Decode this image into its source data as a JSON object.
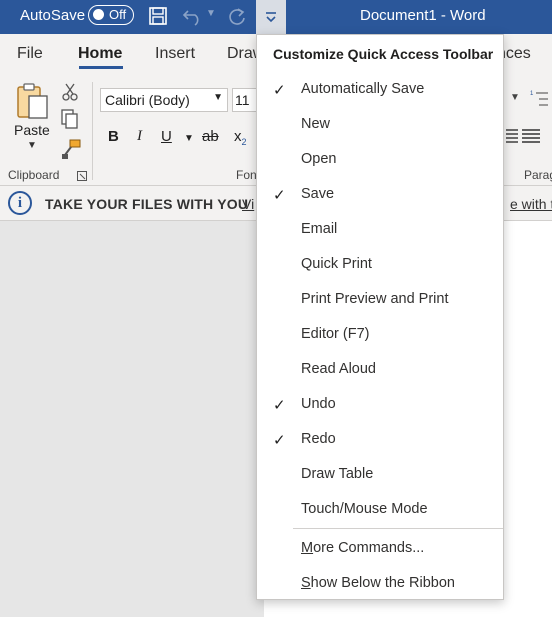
{
  "titlebar": {
    "autosave_label": "AutoSave",
    "autosave_state": "Off",
    "document_title": "Document1  -  Word"
  },
  "tabs": [
    "File",
    "Home",
    "Insert",
    "Draw",
    "nces"
  ],
  "ribbon": {
    "paste_label": "Paste",
    "clipboard_group": "Clipboard",
    "font_name": "Calibri (Body)",
    "font_size": "11",
    "font_group_partial": "Fon",
    "paragraph_group_partial": "Parag",
    "bold": "B",
    "italic": "I",
    "underline": "U",
    "strike": "ab",
    "subscript": "x"
  },
  "infobar": {
    "message": "TAKE YOUR FILES WITH YOU",
    "link_left": "Vi",
    "link_right": "e with th"
  },
  "menu": {
    "title": "Customize Quick Access Toolbar",
    "items": [
      {
        "label": "Automatically Save",
        "checked": true
      },
      {
        "label": "New",
        "checked": false
      },
      {
        "label": "Open",
        "checked": false
      },
      {
        "label": "Save",
        "checked": true
      },
      {
        "label": "Email",
        "checked": false
      },
      {
        "label": "Quick Print",
        "checked": false
      },
      {
        "label": "Print Preview and Print",
        "checked": false
      },
      {
        "label": "Editor (F7)",
        "checked": false
      },
      {
        "label": "Read Aloud",
        "checked": false
      },
      {
        "label": "Undo",
        "checked": true
      },
      {
        "label": "Redo",
        "checked": true
      },
      {
        "label": "Draw Table",
        "checked": false
      },
      {
        "label": "Touch/Mouse Mode",
        "checked": false
      }
    ],
    "more_commands": {
      "accel": "M",
      "rest": "ore Commands..."
    },
    "show_below": {
      "accel": "S",
      "rest": "how Below the Ribbon"
    },
    "check_glyph": "✓"
  },
  "colors": {
    "titlebar": "#2b579a",
    "ribbon": "#f3f2f1"
  }
}
